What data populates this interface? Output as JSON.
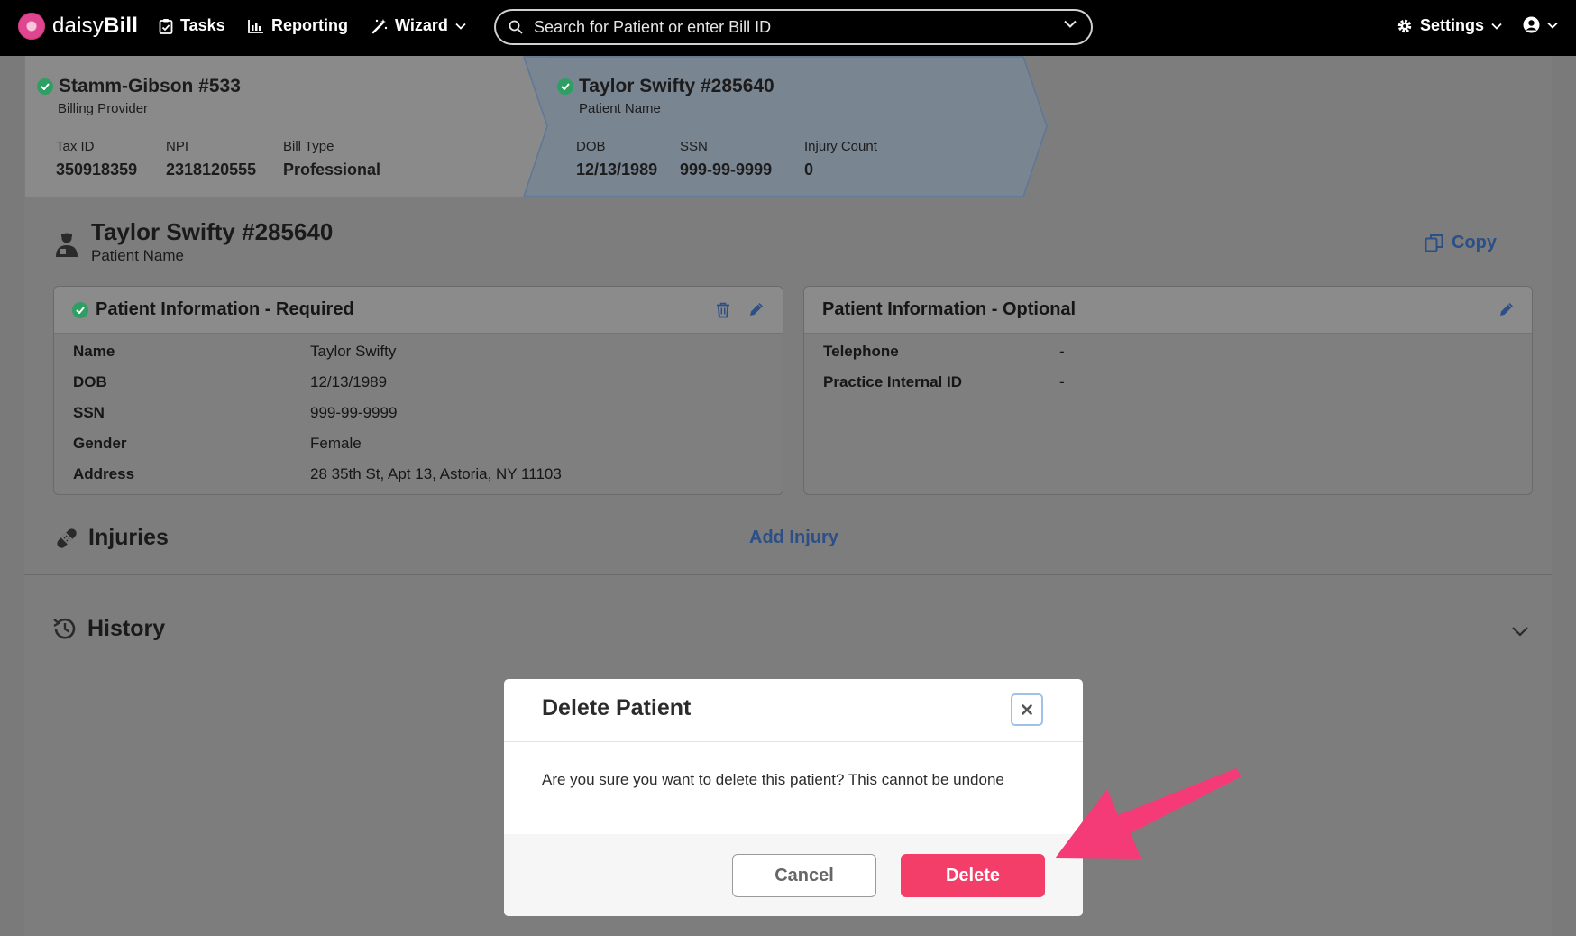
{
  "app": {
    "brand_prefix": "daisy",
    "brand_suffix": "Bill"
  },
  "nav": {
    "tasks": "Tasks",
    "reporting": "Reporting",
    "wizard": "Wizard",
    "search_placeholder": "Search for Patient or enter Bill ID",
    "settings": "Settings"
  },
  "breadcrumb": {
    "provider": {
      "title": "Stamm-Gibson #533",
      "subtitle": "Billing Provider",
      "fields": [
        {
          "label": "Tax ID",
          "value": "350918359"
        },
        {
          "label": "NPI",
          "value": "2318120555"
        },
        {
          "label": "Bill Type",
          "value": "Professional"
        }
      ]
    },
    "patient": {
      "title": "Taylor Swifty #285640",
      "subtitle": "Patient Name",
      "fields": [
        {
          "label": "DOB",
          "value": "12/13/1989"
        },
        {
          "label": "SSN",
          "value": "999-99-9999"
        },
        {
          "label": "Injury Count",
          "value": "0"
        }
      ]
    }
  },
  "patient_header": {
    "title": "Taylor Swifty #285640",
    "subtitle": "Patient Name",
    "copy_label": "Copy"
  },
  "required_panel": {
    "title": "Patient Information - Required",
    "rows": [
      {
        "label": "Name",
        "value": "Taylor Swifty"
      },
      {
        "label": "DOB",
        "value": "12/13/1989"
      },
      {
        "label": "SSN",
        "value": "999-99-9999"
      },
      {
        "label": "Gender",
        "value": "Female"
      },
      {
        "label": "Address",
        "value": "28 35th St, Apt 13, Astoria, NY 11103"
      }
    ]
  },
  "optional_panel": {
    "title": "Patient Information - Optional",
    "rows": [
      {
        "label": "Telephone",
        "value": "-"
      },
      {
        "label": "Practice Internal ID",
        "value": "-"
      }
    ]
  },
  "injuries": {
    "title": "Injuries",
    "add_label": "Add Injury"
  },
  "history": {
    "title": "History"
  },
  "modal": {
    "title": "Delete Patient",
    "message": "Are you sure you want to delete this patient? This cannot be undone",
    "cancel_label": "Cancel",
    "delete_label": "Delete"
  },
  "colors": {
    "danger": "#f23e68",
    "link": "#2b4f86",
    "success": "#2f9e63",
    "annotation_arrow": "#f43b78"
  }
}
